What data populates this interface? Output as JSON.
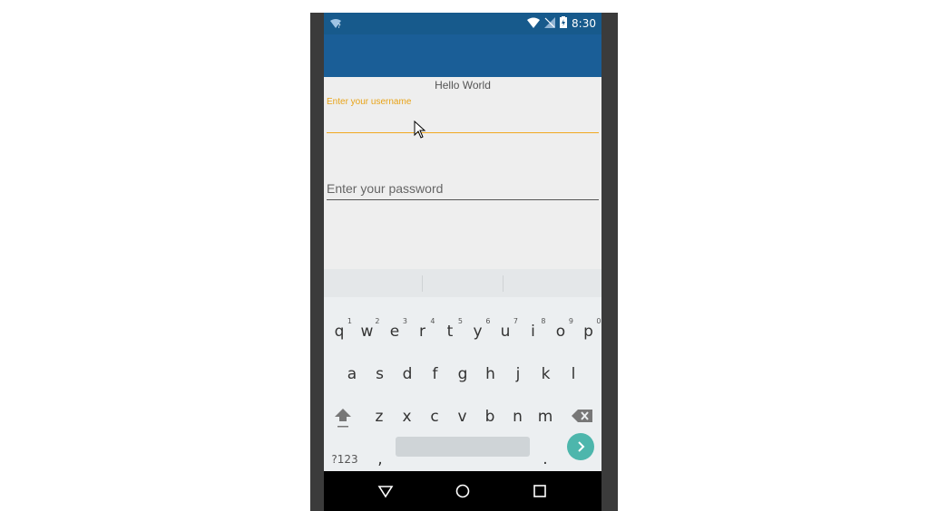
{
  "status_bar": {
    "time": "8:30",
    "icons": [
      "wifi-question-icon",
      "wifi-icon",
      "signal-off-icon",
      "battery-charging-icon"
    ]
  },
  "content": {
    "hello_text": "Hello World",
    "username_label": "Enter your username",
    "password_placeholder": "Enter your password"
  },
  "keyboard": {
    "row1": [
      {
        "key": "q",
        "hint": "1"
      },
      {
        "key": "w",
        "hint": "2"
      },
      {
        "key": "e",
        "hint": "3"
      },
      {
        "key": "r",
        "hint": "4"
      },
      {
        "key": "t",
        "hint": "5"
      },
      {
        "key": "y",
        "hint": "6"
      },
      {
        "key": "u",
        "hint": "7"
      },
      {
        "key": "i",
        "hint": "8"
      },
      {
        "key": "o",
        "hint": "9"
      },
      {
        "key": "p",
        "hint": "0"
      }
    ],
    "row2": [
      "a",
      "s",
      "d",
      "f",
      "g",
      "h",
      "j",
      "k",
      "l"
    ],
    "row3": [
      "z",
      "x",
      "c",
      "v",
      "b",
      "n",
      "m"
    ],
    "symbols_label": "?123",
    "comma": ",",
    "period": "."
  },
  "colors": {
    "app_bar": "#1a5e97",
    "status_bar": "#175a8c",
    "accent": "#f0a820",
    "enter_key": "#4db6ac"
  }
}
